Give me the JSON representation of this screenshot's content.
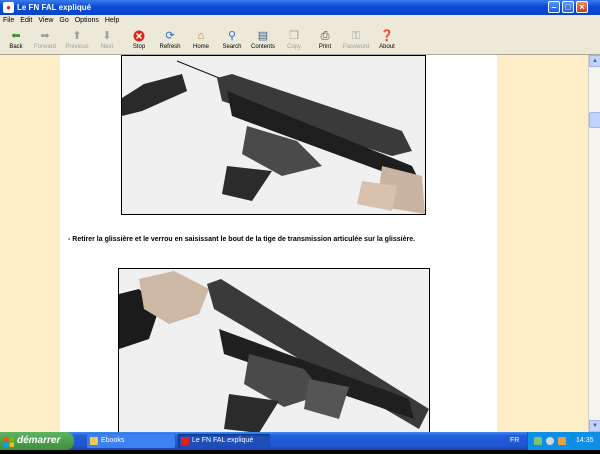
{
  "window": {
    "title": "Le FN FAL expliqué"
  },
  "menu": [
    "File",
    "Edit",
    "View",
    "Go",
    "Options",
    "Help"
  ],
  "toolbar": [
    {
      "label": "Back",
      "icon": "arrow-left-icon",
      "enabled": true
    },
    {
      "label": "Forward",
      "icon": "arrow-right-icon",
      "enabled": false
    },
    {
      "label": "Previous",
      "icon": "arrow-up-icon",
      "enabled": false
    },
    {
      "label": "Next",
      "icon": "arrow-down-icon",
      "enabled": false
    },
    {
      "label": "Stop",
      "icon": "stop-icon",
      "enabled": true
    },
    {
      "label": "Refresh",
      "icon": "refresh-icon",
      "enabled": true
    },
    {
      "label": "Home",
      "icon": "home-icon",
      "enabled": true
    },
    {
      "label": "Search",
      "icon": "search-icon",
      "enabled": true
    },
    {
      "label": "Contents",
      "icon": "contents-icon",
      "enabled": true
    },
    {
      "label": "Copy",
      "icon": "copy-icon",
      "enabled": false
    },
    {
      "label": "Print",
      "icon": "print-icon",
      "enabled": true
    },
    {
      "label": "Password",
      "icon": "key-icon",
      "enabled": false
    },
    {
      "label": "About",
      "icon": "about-icon",
      "enabled": true
    }
  ],
  "content": {
    "caption": "- Retirer la glissière et le verrou en saisissant le bout de la tige de transmission articulée sur la glissière."
  },
  "taskbar": {
    "start_label": "démarrer",
    "tasks": [
      {
        "label": "Ebooks",
        "icon": "folder-icon",
        "active": false
      },
      {
        "label": "Le FN FAL expliqué",
        "icon": "ebook-icon",
        "active": true
      }
    ],
    "tray": {
      "lang": "FR",
      "time": "14:35"
    }
  },
  "colors": {
    "page_background": "#fdeec7",
    "titlebar": "#0a4ad6",
    "taskbar": "#245edb",
    "start_button": "#3c8f3c"
  }
}
